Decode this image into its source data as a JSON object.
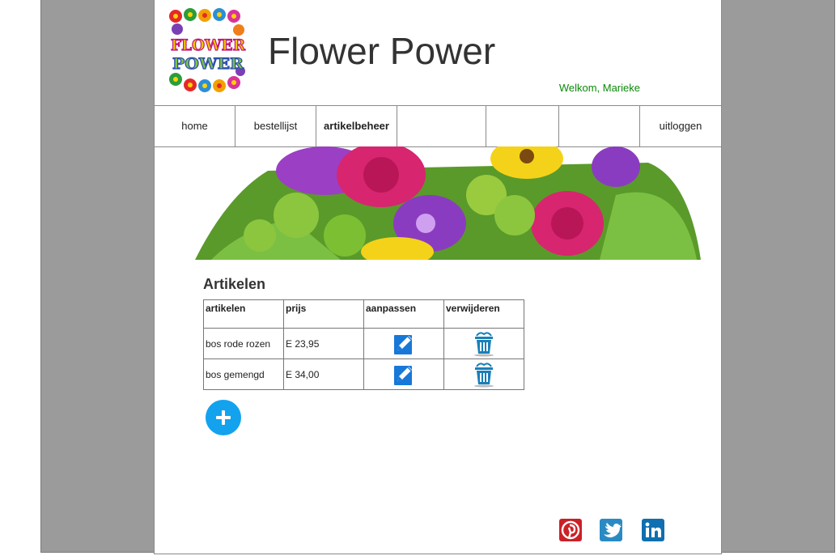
{
  "site": {
    "title": "Flower Power",
    "logo_line1": "FLOWER",
    "logo_line2": "POWER",
    "welcome": "Welkom, Marieke"
  },
  "nav": {
    "items": [
      {
        "label": "home",
        "active": false
      },
      {
        "label": "bestellijst",
        "active": false
      },
      {
        "label": "artikelbeheer",
        "active": true
      },
      {
        "label": "",
        "active": false
      },
      {
        "label": "",
        "active": false
      },
      {
        "label": "",
        "active": false
      },
      {
        "label": "uitloggen",
        "active": false
      }
    ]
  },
  "articles": {
    "heading": "Artikelen",
    "columns": [
      "artikelen",
      "prijs",
      "aanpassen",
      "verwijderen"
    ],
    "rows": [
      {
        "name": "bos rode rozen",
        "price": "E 23,95",
        "edit_icon": "edit-icon",
        "delete_icon": "trash-icon"
      },
      {
        "name": "bos gemengd",
        "price": "E 34,00",
        "edit_icon": "edit-icon",
        "delete_icon": "trash-icon"
      }
    ],
    "add_icon": "plus-icon"
  },
  "social": {
    "icons": [
      "pinterest-icon",
      "twitter-icon",
      "linkedin-icon"
    ]
  },
  "colors": {
    "welcome": "#0a8a0a",
    "add_button": "#13a2ee",
    "pinterest": "#cb2027",
    "twitter": "#2a8bc4",
    "linkedin": "#0f6fb0",
    "frame": "#9b9b9b"
  }
}
